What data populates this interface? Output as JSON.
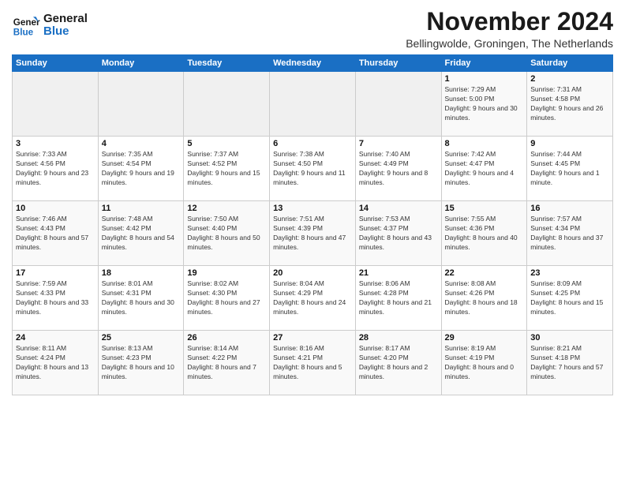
{
  "logo": {
    "line1": "General",
    "line2": "Blue"
  },
  "title": "November 2024",
  "subtitle": "Bellingwolde, Groningen, The Netherlands",
  "days_of_week": [
    "Sunday",
    "Monday",
    "Tuesday",
    "Wednesday",
    "Thursday",
    "Friday",
    "Saturday"
  ],
  "weeks": [
    [
      {
        "day": "",
        "info": ""
      },
      {
        "day": "",
        "info": ""
      },
      {
        "day": "",
        "info": ""
      },
      {
        "day": "",
        "info": ""
      },
      {
        "day": "",
        "info": ""
      },
      {
        "day": "1",
        "info": "Sunrise: 7:29 AM\nSunset: 5:00 PM\nDaylight: 9 hours and 30 minutes."
      },
      {
        "day": "2",
        "info": "Sunrise: 7:31 AM\nSunset: 4:58 PM\nDaylight: 9 hours and 26 minutes."
      }
    ],
    [
      {
        "day": "3",
        "info": "Sunrise: 7:33 AM\nSunset: 4:56 PM\nDaylight: 9 hours and 23 minutes."
      },
      {
        "day": "4",
        "info": "Sunrise: 7:35 AM\nSunset: 4:54 PM\nDaylight: 9 hours and 19 minutes."
      },
      {
        "day": "5",
        "info": "Sunrise: 7:37 AM\nSunset: 4:52 PM\nDaylight: 9 hours and 15 minutes."
      },
      {
        "day": "6",
        "info": "Sunrise: 7:38 AM\nSunset: 4:50 PM\nDaylight: 9 hours and 11 minutes."
      },
      {
        "day": "7",
        "info": "Sunrise: 7:40 AM\nSunset: 4:49 PM\nDaylight: 9 hours and 8 minutes."
      },
      {
        "day": "8",
        "info": "Sunrise: 7:42 AM\nSunset: 4:47 PM\nDaylight: 9 hours and 4 minutes."
      },
      {
        "day": "9",
        "info": "Sunrise: 7:44 AM\nSunset: 4:45 PM\nDaylight: 9 hours and 1 minute."
      }
    ],
    [
      {
        "day": "10",
        "info": "Sunrise: 7:46 AM\nSunset: 4:43 PM\nDaylight: 8 hours and 57 minutes."
      },
      {
        "day": "11",
        "info": "Sunrise: 7:48 AM\nSunset: 4:42 PM\nDaylight: 8 hours and 54 minutes."
      },
      {
        "day": "12",
        "info": "Sunrise: 7:50 AM\nSunset: 4:40 PM\nDaylight: 8 hours and 50 minutes."
      },
      {
        "day": "13",
        "info": "Sunrise: 7:51 AM\nSunset: 4:39 PM\nDaylight: 8 hours and 47 minutes."
      },
      {
        "day": "14",
        "info": "Sunrise: 7:53 AM\nSunset: 4:37 PM\nDaylight: 8 hours and 43 minutes."
      },
      {
        "day": "15",
        "info": "Sunrise: 7:55 AM\nSunset: 4:36 PM\nDaylight: 8 hours and 40 minutes."
      },
      {
        "day": "16",
        "info": "Sunrise: 7:57 AM\nSunset: 4:34 PM\nDaylight: 8 hours and 37 minutes."
      }
    ],
    [
      {
        "day": "17",
        "info": "Sunrise: 7:59 AM\nSunset: 4:33 PM\nDaylight: 8 hours and 33 minutes."
      },
      {
        "day": "18",
        "info": "Sunrise: 8:01 AM\nSunset: 4:31 PM\nDaylight: 8 hours and 30 minutes."
      },
      {
        "day": "19",
        "info": "Sunrise: 8:02 AM\nSunset: 4:30 PM\nDaylight: 8 hours and 27 minutes."
      },
      {
        "day": "20",
        "info": "Sunrise: 8:04 AM\nSunset: 4:29 PM\nDaylight: 8 hours and 24 minutes."
      },
      {
        "day": "21",
        "info": "Sunrise: 8:06 AM\nSunset: 4:28 PM\nDaylight: 8 hours and 21 minutes."
      },
      {
        "day": "22",
        "info": "Sunrise: 8:08 AM\nSunset: 4:26 PM\nDaylight: 8 hours and 18 minutes."
      },
      {
        "day": "23",
        "info": "Sunrise: 8:09 AM\nSunset: 4:25 PM\nDaylight: 8 hours and 15 minutes."
      }
    ],
    [
      {
        "day": "24",
        "info": "Sunrise: 8:11 AM\nSunset: 4:24 PM\nDaylight: 8 hours and 13 minutes."
      },
      {
        "day": "25",
        "info": "Sunrise: 8:13 AM\nSunset: 4:23 PM\nDaylight: 8 hours and 10 minutes."
      },
      {
        "day": "26",
        "info": "Sunrise: 8:14 AM\nSunset: 4:22 PM\nDaylight: 8 hours and 7 minutes."
      },
      {
        "day": "27",
        "info": "Sunrise: 8:16 AM\nSunset: 4:21 PM\nDaylight: 8 hours and 5 minutes."
      },
      {
        "day": "28",
        "info": "Sunrise: 8:17 AM\nSunset: 4:20 PM\nDaylight: 8 hours and 2 minutes."
      },
      {
        "day": "29",
        "info": "Sunrise: 8:19 AM\nSunset: 4:19 PM\nDaylight: 8 hours and 0 minutes."
      },
      {
        "day": "30",
        "info": "Sunrise: 8:21 AM\nSunset: 4:18 PM\nDaylight: 7 hours and 57 minutes."
      }
    ]
  ]
}
